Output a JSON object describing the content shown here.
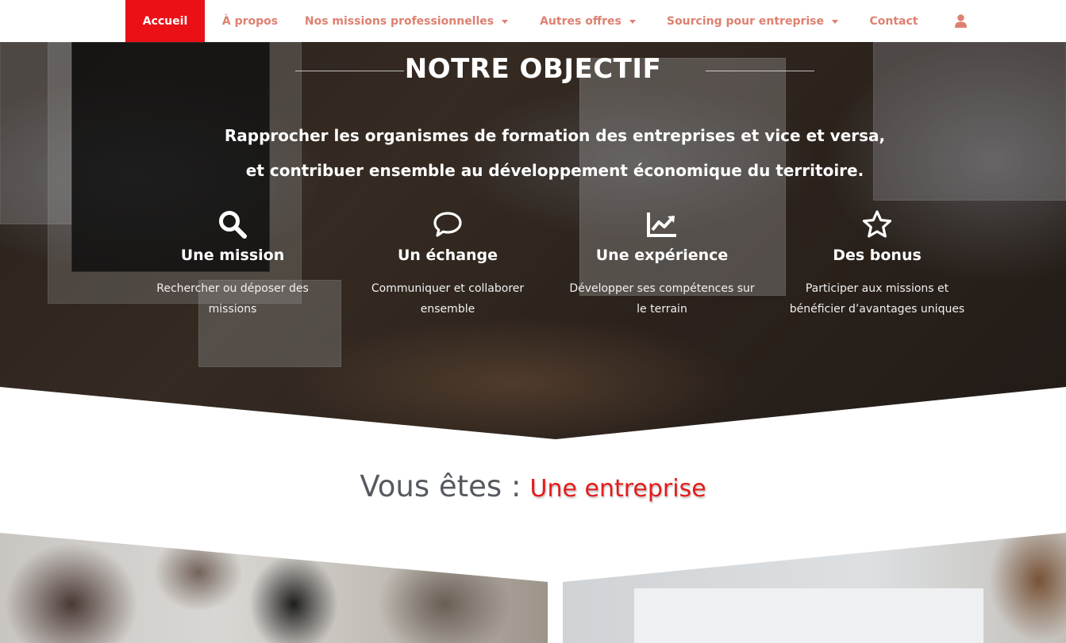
{
  "nav": {
    "items": [
      {
        "label": "Accueil",
        "active": true,
        "dropdown": false
      },
      {
        "label": "À propos",
        "active": false,
        "dropdown": false
      },
      {
        "label": "Nos missions professionnelles",
        "active": false,
        "dropdown": true
      },
      {
        "label": "Autres offres",
        "active": false,
        "dropdown": true
      },
      {
        "label": "Sourcing pour entreprise",
        "active": false,
        "dropdown": true
      },
      {
        "label": "Contact",
        "active": false,
        "dropdown": false
      }
    ],
    "user_icon": "user-icon"
  },
  "hero": {
    "title": "NOTRE OBJECTIF",
    "description_line1": "Rapprocher les organismes de formation des entreprises et vice et versa,",
    "description_line2": "et contribuer ensemble au développement économique du territoire.",
    "features": [
      {
        "icon": "search-icon",
        "title": "Une mission",
        "text": "Rechercher ou déposer des missions"
      },
      {
        "icon": "chat-bubble-icon",
        "title": "Un échange",
        "text": "Communiquer et collaborer ensemble"
      },
      {
        "icon": "chart-line-icon",
        "title": "Une expérience",
        "text": "Développer ses compétences sur le terrain"
      },
      {
        "icon": "star-icon",
        "title": "Des bonus",
        "text": "Participer aux missions et bénéficier d’avantages uniques"
      }
    ]
  },
  "vous": {
    "prefix": "Vous êtes :",
    "choice": "Une entreprise"
  },
  "colors": {
    "accent": "#ea1016",
    "nav_text": "#de8070",
    "heading_gray": "#555a60",
    "choice_red": "#e31b1b"
  }
}
